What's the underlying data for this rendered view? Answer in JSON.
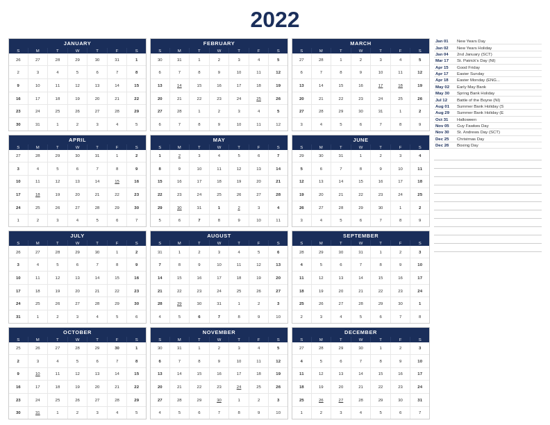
{
  "title": "2022",
  "months": [
    {
      "name": "JANUARY",
      "weeks": [
        [
          "26",
          "27",
          "28",
          "29",
          "30",
          "31",
          "1"
        ],
        [
          "2",
          "3",
          "4",
          "5",
          "6",
          "7",
          "8"
        ],
        [
          "9",
          "10",
          "11",
          "12",
          "13",
          "14",
          "15"
        ],
        [
          "16",
          "17",
          "18",
          "19",
          "20",
          "21",
          "22"
        ],
        [
          "23",
          "24",
          "25",
          "26",
          "27",
          "28",
          "29"
        ],
        [
          "30",
          "31",
          "1",
          "2",
          "3",
          "4",
          "5"
        ]
      ],
      "otherStart": [
        "26",
        "27",
        "28",
        "29",
        "30",
        "31"
      ],
      "otherEnd": [
        "26",
        "27",
        "28",
        "29",
        "30",
        "31",
        "1",
        "2",
        "3",
        "4",
        "5"
      ],
      "highlights": {
        "red": [
          "9",
          "16",
          "23",
          "30"
        ],
        "blue": [
          "15",
          "22",
          "29"
        ],
        "underline": []
      }
    },
    {
      "name": "FEBRUARY",
      "weeks": [
        [
          "30",
          "31",
          "1",
          "2",
          "3",
          "4",
          "5"
        ],
        [
          "6",
          "7",
          "8",
          "9",
          "10",
          "11",
          "12"
        ],
        [
          "13",
          "14",
          "15",
          "16",
          "17",
          "18",
          "19"
        ],
        [
          "20",
          "21",
          "22",
          "23",
          "24",
          "25",
          "26"
        ],
        [
          "27",
          "28",
          "1",
          "2",
          "3",
          "4",
          "5"
        ],
        [
          "6",
          "7",
          "8",
          "9",
          "10",
          "11",
          "12"
        ]
      ],
      "highlights": {
        "red": [
          "13",
          "20",
          "27"
        ],
        "blue": [
          "5",
          "12",
          "19",
          "26"
        ],
        "underline": [
          "14",
          "25"
        ]
      }
    },
    {
      "name": "MARCH",
      "weeks": [
        [
          "27",
          "28",
          "1",
          "2",
          "3",
          "4",
          "5"
        ],
        [
          "6",
          "7",
          "8",
          "9",
          "10",
          "11",
          "12"
        ],
        [
          "13",
          "14",
          "15",
          "16",
          "17",
          "18",
          "19"
        ],
        [
          "20",
          "21",
          "22",
          "23",
          "24",
          "25",
          "26"
        ],
        [
          "27",
          "28",
          "29",
          "30",
          "31",
          "1",
          "2"
        ],
        [
          "3",
          "4",
          "5",
          "6",
          "7",
          "8",
          "9"
        ]
      ],
      "highlights": {
        "red": [
          "13",
          "20",
          "27"
        ],
        "blue": [
          "5",
          "12",
          "19",
          "26"
        ],
        "underline": [
          "17",
          "18"
        ]
      }
    },
    {
      "name": "APRIL",
      "weeks": [
        [
          "27",
          "28",
          "29",
          "30",
          "31",
          "1",
          "2"
        ],
        [
          "3",
          "4",
          "5",
          "6",
          "7",
          "8",
          "9"
        ],
        [
          "10",
          "11",
          "12",
          "13",
          "14",
          "15",
          "16"
        ],
        [
          "17",
          "18",
          "19",
          "20",
          "21",
          "22",
          "23"
        ],
        [
          "24",
          "25",
          "26",
          "27",
          "28",
          "29",
          "30"
        ],
        [
          "1",
          "2",
          "3",
          "4",
          "5",
          "6",
          "7"
        ]
      ],
      "highlights": {
        "red": [
          "3",
          "10",
          "17",
          "24"
        ],
        "blue": [
          "2",
          "9",
          "16",
          "23",
          "30"
        ],
        "underline": [
          "15",
          "17",
          "18"
        ]
      }
    },
    {
      "name": "MAY",
      "weeks": [
        [
          "1",
          "2",
          "3",
          "4",
          "5",
          "6",
          "7"
        ],
        [
          "8",
          "9",
          "10",
          "11",
          "12",
          "13",
          "14"
        ],
        [
          "15",
          "16",
          "17",
          "18",
          "19",
          "20",
          "21"
        ],
        [
          "22",
          "23",
          "24",
          "25",
          "26",
          "27",
          "28"
        ],
        [
          "29",
          "30",
          "31",
          "1",
          "2",
          "3",
          "4"
        ],
        [
          "5",
          "6",
          "7",
          "8",
          "9",
          "10",
          "11"
        ]
      ],
      "highlights": {
        "red": [
          "1",
          "8",
          "15",
          "22",
          "29"
        ],
        "blue": [
          "7",
          "14",
          "21",
          "28"
        ],
        "underline": [
          "2",
          "30"
        ]
      }
    },
    {
      "name": "JUNE",
      "weeks": [
        [
          "29",
          "30",
          "31",
          "1",
          "2",
          "3",
          "4"
        ],
        [
          "5",
          "6",
          "7",
          "8",
          "9",
          "10",
          "11"
        ],
        [
          "12",
          "13",
          "14",
          "15",
          "16",
          "17",
          "18"
        ],
        [
          "19",
          "20",
          "21",
          "22",
          "23",
          "24",
          "25"
        ],
        [
          "26",
          "27",
          "28",
          "29",
          "30",
          "1",
          "2"
        ],
        [
          "3",
          "4",
          "5",
          "6",
          "7",
          "8",
          "9"
        ]
      ],
      "highlights": {
        "red": [
          "5",
          "12",
          "19",
          "26"
        ],
        "blue": [
          "4",
          "11",
          "18",
          "25"
        ],
        "underline": []
      }
    },
    {
      "name": "JULY",
      "weeks": [
        [
          "26",
          "27",
          "28",
          "29",
          "30",
          "1",
          "2"
        ],
        [
          "3",
          "4",
          "5",
          "6",
          "7",
          "8",
          "9"
        ],
        [
          "10",
          "11",
          "12",
          "13",
          "14",
          "15",
          "16"
        ],
        [
          "17",
          "18",
          "19",
          "20",
          "21",
          "22",
          "23"
        ],
        [
          "24",
          "25",
          "26",
          "27",
          "28",
          "29",
          "30"
        ],
        [
          "31",
          "1",
          "2",
          "3",
          "4",
          "5",
          "6"
        ]
      ],
      "highlights": {
        "red": [
          "3",
          "10",
          "17",
          "24",
          "31"
        ],
        "blue": [
          "2",
          "9",
          "16",
          "23",
          "30"
        ],
        "underline": []
      }
    },
    {
      "name": "AUGUST",
      "weeks": [
        [
          "31",
          "1",
          "2",
          "3",
          "4",
          "5",
          "6"
        ],
        [
          "7",
          "8",
          "9",
          "10",
          "11",
          "12",
          "13"
        ],
        [
          "14",
          "15",
          "16",
          "17",
          "18",
          "19",
          "20"
        ],
        [
          "21",
          "22",
          "23",
          "24",
          "25",
          "26",
          "27"
        ],
        [
          "28",
          "29",
          "30",
          "31",
          "1",
          "2",
          "3"
        ],
        [
          "4",
          "5",
          "6",
          "7",
          "8",
          "9",
          "10"
        ]
      ],
      "highlights": {
        "red": [
          "7",
          "14",
          "21",
          "28"
        ],
        "blue": [
          "6",
          "13",
          "20",
          "27"
        ],
        "underline": [
          "29"
        ]
      }
    },
    {
      "name": "SEPTEMBER",
      "weeks": [
        [
          "28",
          "29",
          "30",
          "31",
          "1",
          "2",
          "3"
        ],
        [
          "4",
          "5",
          "6",
          "7",
          "8",
          "9",
          "10"
        ],
        [
          "11",
          "12",
          "13",
          "14",
          "15",
          "16",
          "17"
        ],
        [
          "18",
          "19",
          "20",
          "21",
          "22",
          "23",
          "24"
        ],
        [
          "25",
          "26",
          "27",
          "28",
          "29",
          "30",
          "1"
        ],
        [
          "2",
          "3",
          "4",
          "5",
          "6",
          "7",
          "8"
        ]
      ],
      "highlights": {
        "red": [
          "4",
          "11",
          "18",
          "25"
        ],
        "blue": [
          "3",
          "10",
          "17",
          "24"
        ],
        "underline": []
      }
    },
    {
      "name": "OCTOBER",
      "weeks": [
        [
          "25",
          "26",
          "27",
          "28",
          "29",
          "30",
          "1"
        ],
        [
          "2",
          "3",
          "4",
          "5",
          "6",
          "7",
          "8"
        ],
        [
          "9",
          "10",
          "11",
          "12",
          "13",
          "14",
          "15"
        ],
        [
          "16",
          "17",
          "18",
          "19",
          "20",
          "21",
          "22"
        ],
        [
          "23",
          "24",
          "25",
          "26",
          "27",
          "28",
          "29"
        ],
        [
          "30",
          "31",
          "1",
          "2",
          "3",
          "4",
          "5"
        ]
      ],
      "highlights": {
        "red": [
          "2",
          "9",
          "16",
          "23",
          "30"
        ],
        "blue": [
          "1",
          "8",
          "15",
          "22",
          "29"
        ],
        "underline": [
          "10",
          "31"
        ]
      }
    },
    {
      "name": "NOVEMBER",
      "weeks": [
        [
          "30",
          "31",
          "1",
          "2",
          "3",
          "4",
          "5"
        ],
        [
          "6",
          "7",
          "8",
          "9",
          "10",
          "11",
          "12"
        ],
        [
          "13",
          "14",
          "15",
          "16",
          "17",
          "18",
          "19"
        ],
        [
          "20",
          "21",
          "22",
          "23",
          "24",
          "25",
          "26"
        ],
        [
          "27",
          "28",
          "29",
          "30",
          "1",
          "2",
          "3"
        ],
        [
          "4",
          "5",
          "6",
          "7",
          "8",
          "9",
          "10"
        ]
      ],
      "highlights": {
        "red": [
          "6",
          "13",
          "20",
          "27"
        ],
        "blue": [
          "5",
          "12",
          "19",
          "26"
        ],
        "underline": [
          "24",
          "30"
        ]
      }
    },
    {
      "name": "DECEMBER",
      "weeks": [
        [
          "27",
          "28",
          "29",
          "30",
          "1",
          "2",
          "3"
        ],
        [
          "4",
          "5",
          "6",
          "7",
          "8",
          "9",
          "10"
        ],
        [
          "11",
          "12",
          "13",
          "14",
          "15",
          "16",
          "17"
        ],
        [
          "18",
          "19",
          "20",
          "21",
          "22",
          "23",
          "24"
        ],
        [
          "25",
          "26",
          "27",
          "28",
          "29",
          "30",
          "31"
        ],
        [
          "1",
          "2",
          "3",
          "4",
          "5",
          "6",
          "7"
        ]
      ],
      "highlights": {
        "red": [
          "4",
          "11",
          "18",
          "25"
        ],
        "blue": [
          "3",
          "10",
          "17",
          "24",
          "31"
        ],
        "underline": [
          "25",
          "26",
          "27"
        ]
      }
    }
  ],
  "dayHeaders": [
    "S",
    "M",
    "T",
    "W",
    "T",
    "F",
    "S"
  ],
  "holidays": [
    {
      "date": "Jan 01",
      "name": "New Years Day"
    },
    {
      "date": "Jan 02",
      "name": "New Years Holiday"
    },
    {
      "date": "Jan 04",
      "name": "2nd January (SCT)"
    },
    {
      "date": "Mar 17",
      "name": "St. Patrick's Day (NI)"
    },
    {
      "date": "Apr 15",
      "name": "Good Friday"
    },
    {
      "date": "Apr 17",
      "name": "Easter Sunday"
    },
    {
      "date": "Apr 18",
      "name": "Easter Monday (ENG..."
    },
    {
      "date": "May 02",
      "name": "Early May Bank"
    },
    {
      "date": "May 30",
      "name": "Spring Bank Holiday"
    },
    {
      "date": "Jul 12",
      "name": "Battle of the Boyne (NI)"
    },
    {
      "date": "Aug 01",
      "name": "Summer Bank Holiday (S"
    },
    {
      "date": "Aug 29",
      "name": "Summer Bank Holiday (E"
    },
    {
      "date": "Oct 31",
      "name": "Halloween"
    },
    {
      "date": "Nov 05",
      "name": "Guy Fawkes Day"
    },
    {
      "date": "Nov 30",
      "name": "St. Andrews Day (SCT)"
    },
    {
      "date": "Dec 25",
      "name": "Christmas Day"
    },
    {
      "date": "Dec 26",
      "name": "Boxing Day"
    }
  ]
}
